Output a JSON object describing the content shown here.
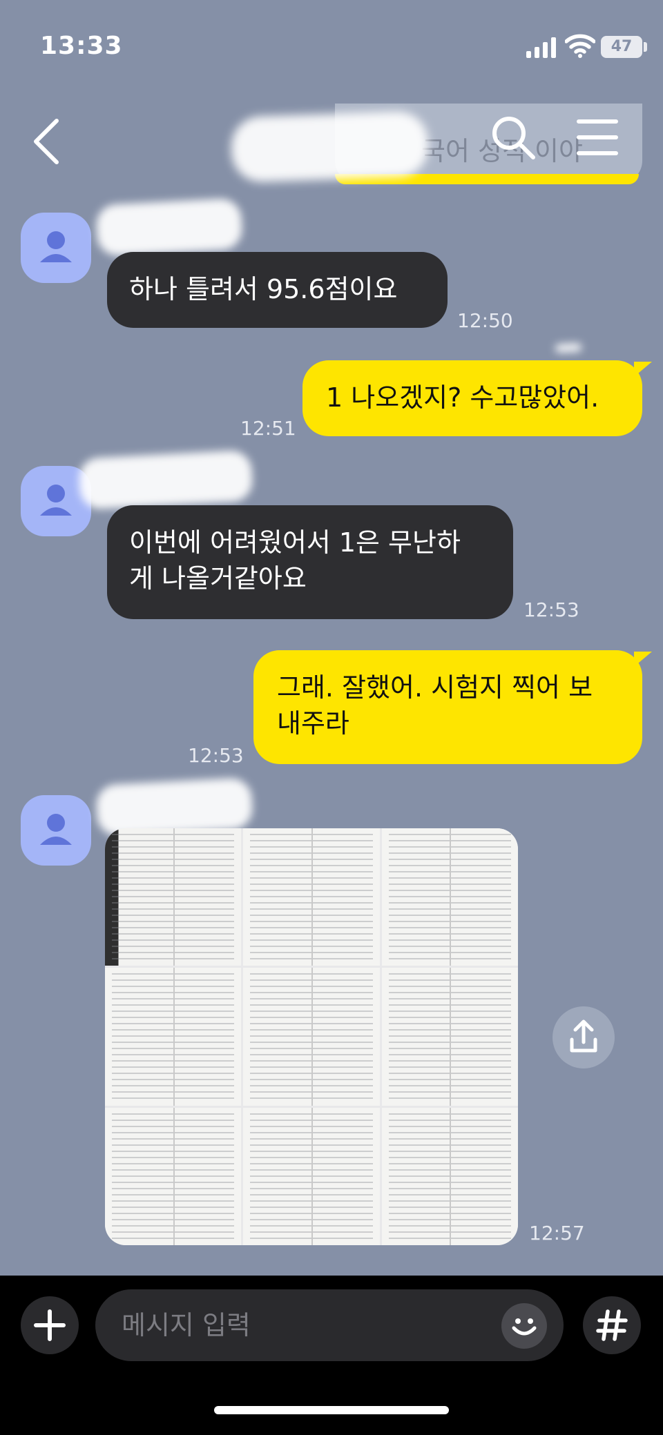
{
  "status_bar": {
    "time": "13:33",
    "battery": "47"
  },
  "header": {
    "notice_preview": "국어 성적 이야"
  },
  "messages": [
    {
      "sender": "other",
      "text": "하나 틀려서 95.6점이요",
      "time": "12:50"
    },
    {
      "sender": "me",
      "text": "1 나오겠지? 수고많았어.",
      "time": "12:51"
    },
    {
      "sender": "other",
      "lines": [
        "이번에 어려웠어서 1은 무난하",
        "게 나올거같아요"
      ],
      "time": "12:53"
    },
    {
      "sender": "me",
      "lines": [
        "그래. 잘했어. 시험지 찍어 보",
        "내주라"
      ],
      "time": "12:53"
    },
    {
      "sender": "other",
      "type": "photos",
      "photo_count": 9,
      "time": "12:57"
    }
  ],
  "input": {
    "placeholder": "메시지 입력"
  },
  "colors": {
    "background": "#8590a7",
    "my_bubble": "#fee500",
    "other_bubble": "#2e2e31",
    "avatar": "#a4b5f7"
  },
  "icons": [
    "back-arrow-icon",
    "search-icon",
    "menu-icon",
    "person-icon",
    "share-icon",
    "plus-icon",
    "emoji-icon",
    "hash-icon"
  ]
}
